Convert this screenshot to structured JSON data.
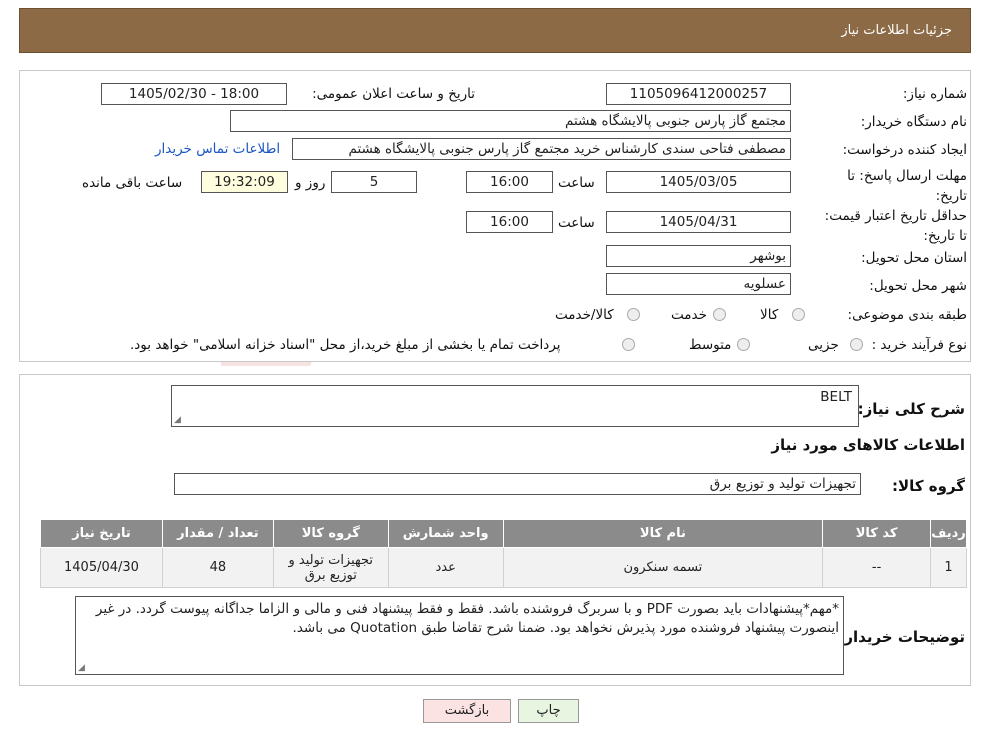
{
  "header": {
    "title": "جزئیات اطلاعات نیاز"
  },
  "fields": {
    "need_number_label": "شماره نیاز:",
    "need_number": "1105096412000257",
    "announce_label": "تاریخ و ساعت اعلان عمومی:",
    "announce_value": "1405/02/30 - 18:00",
    "buyer_label": "نام دستگاه خریدار:",
    "buyer_value": "مجتمع گاز پارس جنوبی  پالایشگاه هشتم",
    "creator_label": "ایجاد کننده درخواست:",
    "creator_value": "مصطفی فتاحی سندی کارشناس خرید مجتمع گاز پارس جنوبی  پالایشگاه هشتم",
    "contact_link": "اطلاعات تماس خریدار",
    "deadline_label": "مهلت ارسال پاسخ: تا تاریخ:",
    "deadline_date": "1405/03/05",
    "time_label": "ساعت",
    "deadline_time": "16:00",
    "days_value": "5",
    "days_label": "روز و",
    "remaining_time": "19:32:09",
    "remaining_label": "ساعت باقی مانده",
    "validity_label": "حداقل تاریخ اعتبار قیمت: تا تاریخ:",
    "validity_date": "1405/04/31",
    "validity_time": "16:00",
    "province_label": "استان محل تحویل:",
    "province_value": "بوشهر",
    "city_label": "شهر محل تحویل:",
    "city_value": "عسلویه",
    "category_label": "طبقه بندی موضوعی:",
    "category_options": [
      "کالا",
      "خدمت",
      "کالا/خدمت"
    ],
    "process_label": "نوع فرآیند خرید :",
    "process_options": [
      "جزیی",
      "متوسط"
    ],
    "process_note": "پرداخت تمام یا بخشی از مبلغ خرید،از محل \"اسناد خزانه اسلامی\" خواهد بود."
  },
  "summary": {
    "label": "شرح کلی نیاز:",
    "value": "BELT",
    "goods_info_title": "اطلاعات کالاهای مورد نیاز",
    "group_label": "گروه کالا:",
    "group_value": "تجهیزات تولید و توزیع برق"
  },
  "table": {
    "headers": [
      "ردیف",
      "کد کالا",
      "نام کالا",
      "واحد شمارش",
      "گروه کالا",
      "تعداد / مقدار",
      "تاریخ نیاز"
    ],
    "rows": [
      [
        "1",
        "--",
        "تسمه سنکرون",
        "عدد",
        "تجهیزات تولید و توزیع برق",
        "48",
        "1405/04/30"
      ]
    ]
  },
  "notes": {
    "label": "توضیحات خریدار:",
    "value": "*مهم*پیشنهادات باید بصورت PDF و با سربرگ فروشنده باشد. فقط و فقط پیشنهاد فنی و مالی و الزاما جداگانه پیوست گردد. در غیر اینصورت پیشنهاد فروشنده مورد پذیرش نخواهد بود. ضمنا شرح تقاضا طبق Quotation می باشد."
  },
  "buttons": {
    "print": "چاپ",
    "back": "بازگشت"
  },
  "watermark": {
    "text": "AriaTender.neT"
  },
  "colors": {
    "header_bg": "#8b6a45",
    "table_header_bg": "#8b8b8b",
    "link": "#1a56c4",
    "print_btn": "#e8f5e0",
    "back_btn": "#fbe3e3"
  }
}
